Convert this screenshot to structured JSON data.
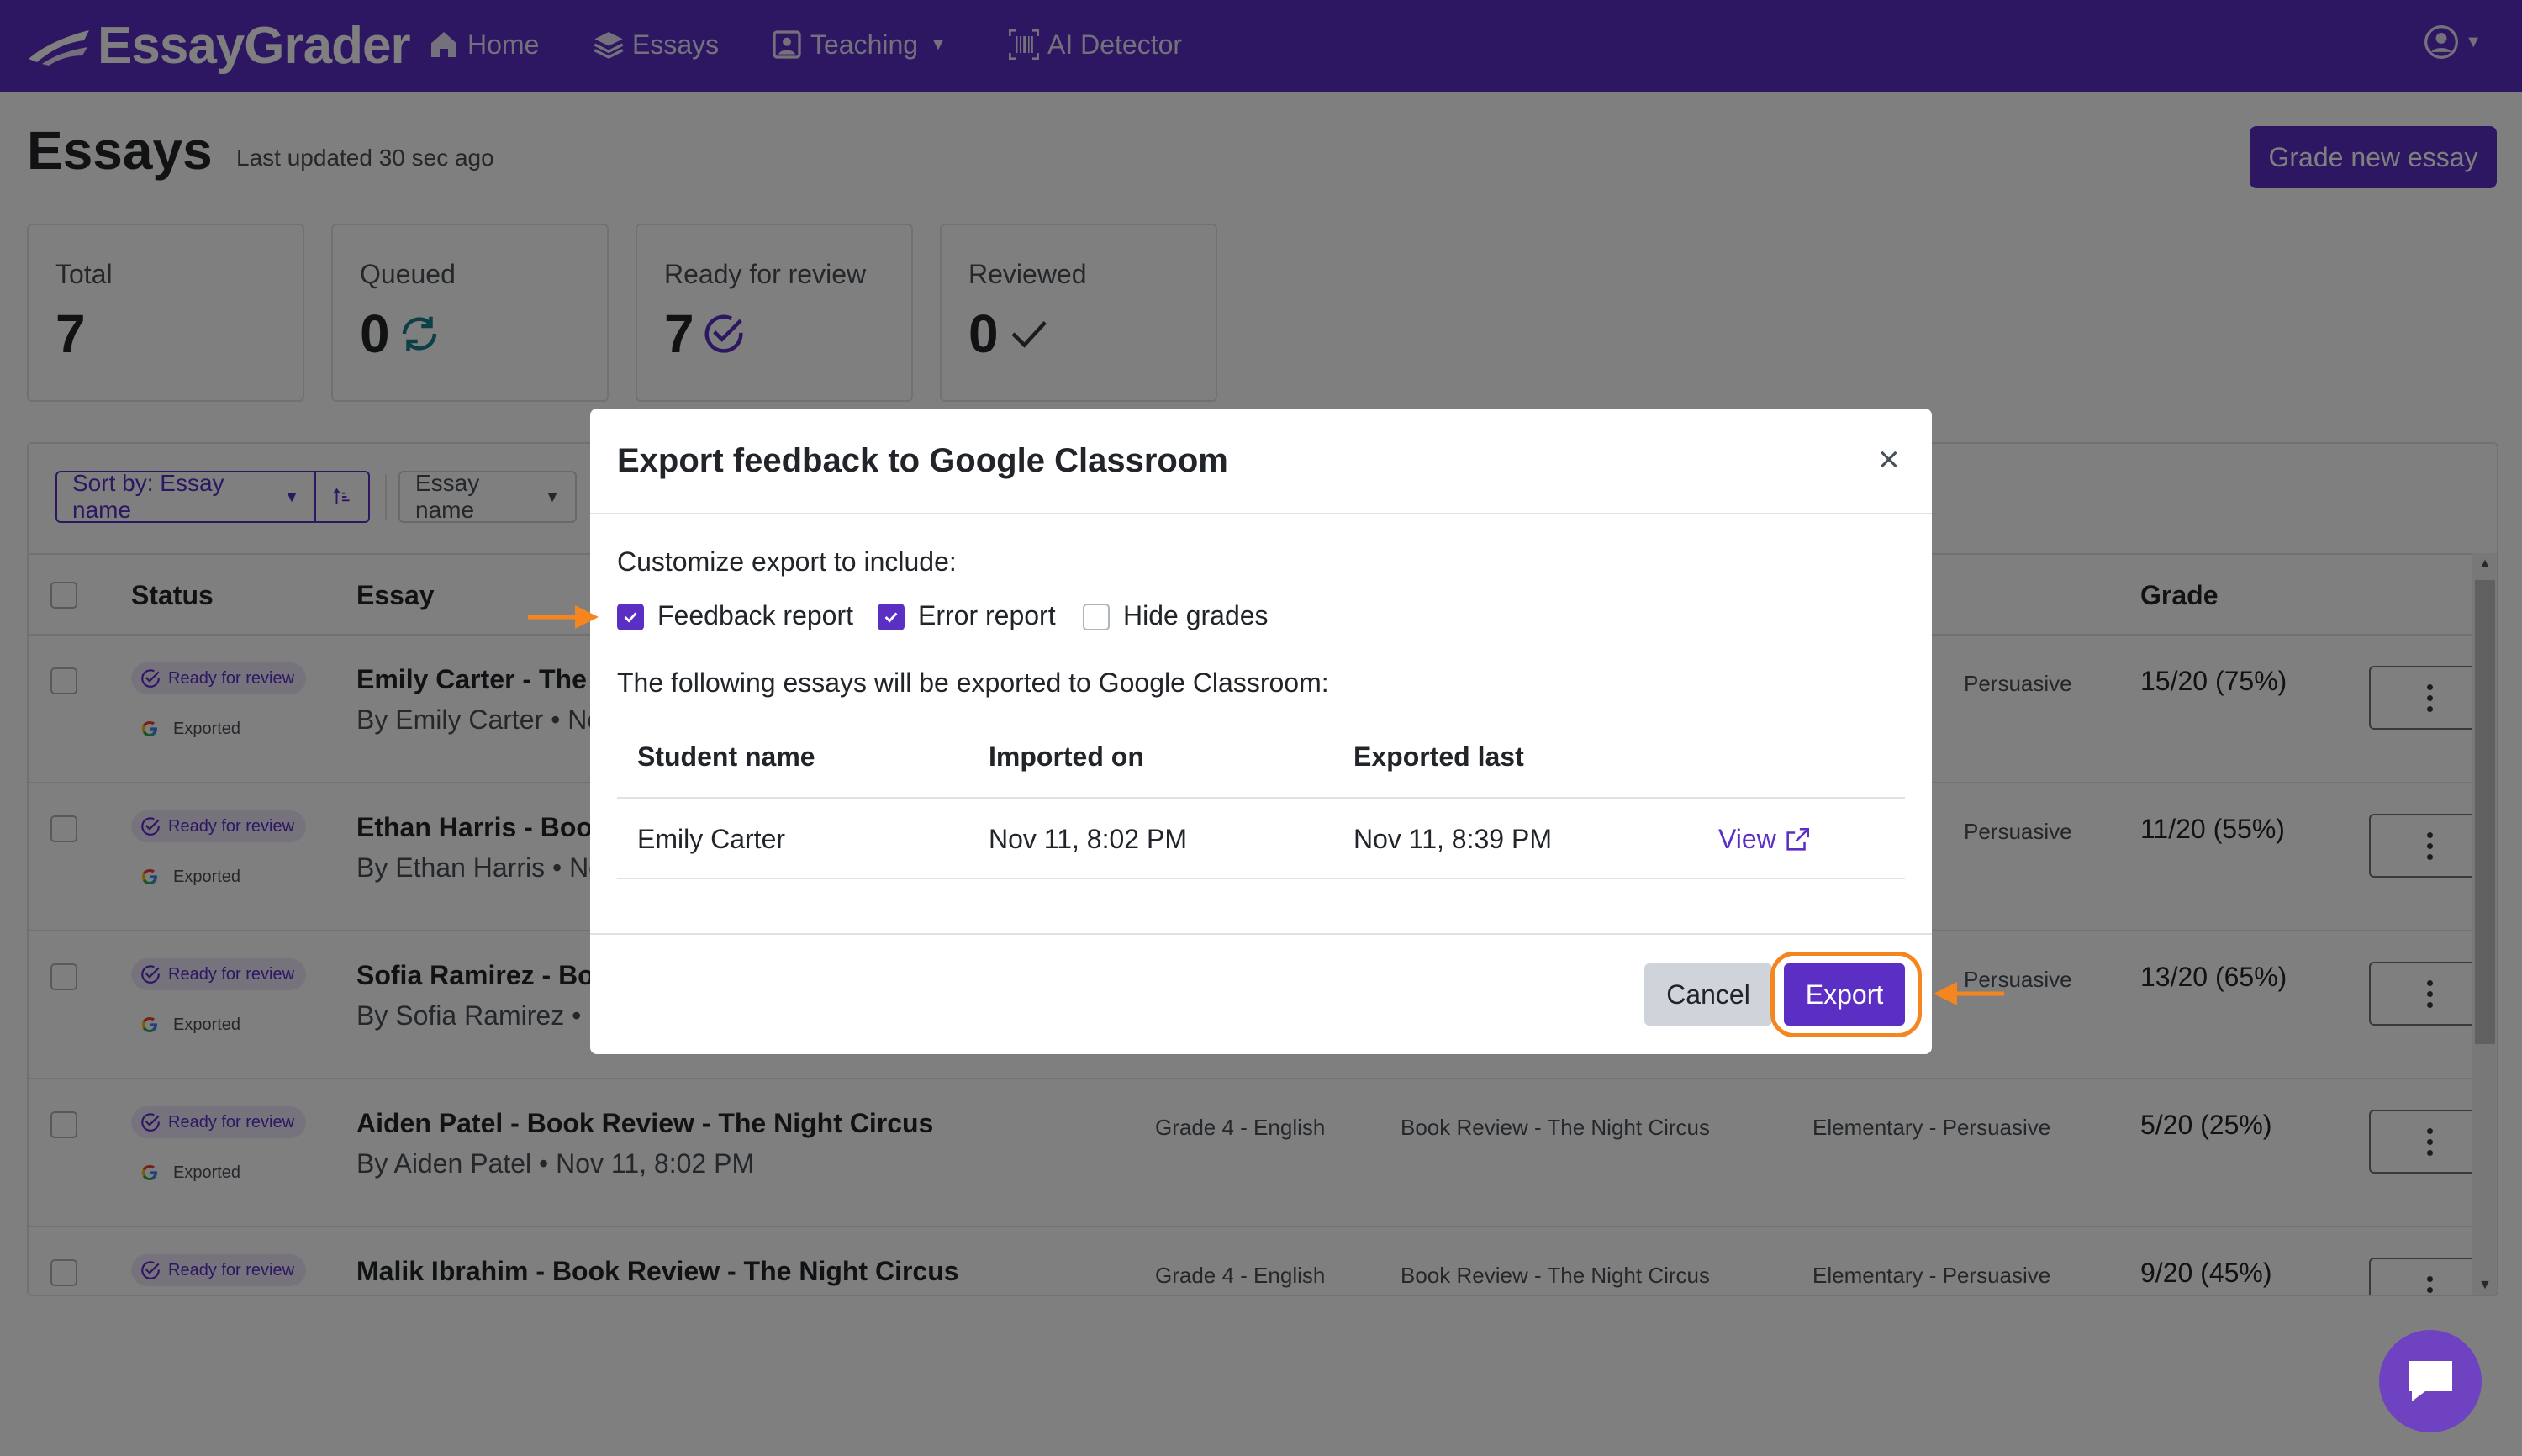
{
  "navbar": {
    "brand": "EssayGrader",
    "items": [
      {
        "label": "Home",
        "icon": "home-icon"
      },
      {
        "label": "Essays",
        "icon": "layers-icon"
      },
      {
        "label": "Teaching",
        "icon": "portrait-icon"
      },
      {
        "label": "AI Detector",
        "icon": "barcode-icon"
      }
    ],
    "user_icon": "user-circle-icon"
  },
  "page": {
    "title": "Essays",
    "subtitle": "Last updated 30 sec ago",
    "grade_button": "Grade new essay"
  },
  "stats": [
    {
      "label": "Total",
      "value": "7"
    },
    {
      "label": "Queued",
      "value": "0",
      "icon": "refresh-icon"
    },
    {
      "label": "Ready for review",
      "value": "7",
      "icon": "check-circle-icon"
    },
    {
      "label": "Reviewed",
      "value": "0",
      "icon": "check-icon"
    }
  ],
  "toolbar": {
    "sort_label": "Sort by: Essay name",
    "filter_label": "Essay name"
  },
  "table": {
    "headers": {
      "status": "Status",
      "essay": "Essay",
      "grade": "Grade"
    },
    "rows": [
      {
        "status": "Ready for review",
        "exported": "Exported",
        "title": "Emily Carter - The",
        "by": "By Emily Carter • No",
        "rubric": "Persuasive",
        "grade": "15/20 (75%)"
      },
      {
        "status": "Ready for review",
        "exported": "Exported",
        "title": "Ethan Harris - Boo",
        "by": "By Ethan Harris • No",
        "rubric": "Persuasive",
        "grade": "11/20 (55%)"
      },
      {
        "status": "Ready for review",
        "exported": "Exported",
        "title": "Sofia Ramirez - Bo",
        "by": "By Sofia Ramirez • N",
        "rubric": "Persuasive",
        "grade": "13/20 (65%)"
      },
      {
        "status": "Ready for review",
        "exported": "Exported",
        "title": "Aiden Patel - Book Review - The Night Circus",
        "by": "By Aiden Patel • Nov 11, 8:02 PM",
        "class": "Grade 4 - English",
        "assignment": "Book Review - The Night Circus",
        "rubric": "Elementary - Persuasive",
        "grade": "5/20 (25%)"
      },
      {
        "status": "Ready for review",
        "title": "Malik Ibrahim - Book Review - The Night Circus",
        "class": "Grade 4 - English",
        "assignment": "Book Review - The Night Circus",
        "rubric": "Elementary - Persuasive",
        "grade": "9/20 (45%)"
      }
    ]
  },
  "modal": {
    "title": "Export feedback to Google Classroom",
    "close": "×",
    "customize_label": "Customize export to include:",
    "options": [
      {
        "label": "Feedback report",
        "checked": true
      },
      {
        "label": "Error report",
        "checked": true
      },
      {
        "label": "Hide grades",
        "checked": false
      }
    ],
    "list_intro": "The following essays will be exported to Google Classroom:",
    "columns": [
      "Student name",
      "Imported on",
      "Exported last"
    ],
    "rows": [
      {
        "student": "Emily Carter",
        "imported": "Nov 11, 8:02 PM",
        "exported": "Nov 11, 8:39 PM",
        "link": "View"
      }
    ],
    "cancel": "Cancel",
    "export": "Export"
  },
  "colors": {
    "brand": "#5b2fc4",
    "highlight": "#f5851f"
  }
}
